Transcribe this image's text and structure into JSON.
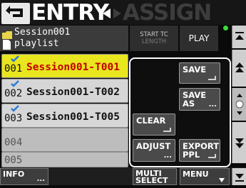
{
  "header": {
    "back_icon": "back-arrow-icon",
    "tab_entry": "ENTRY",
    "tab_arrows_icon": "left-right-arrows-icon",
    "tab_assign": "ASSIGN"
  },
  "session": {
    "name": "Session001",
    "playlist": "playlist",
    "folder_icon": "folder-icon",
    "doc_icon": "document-icon"
  },
  "columns": {
    "start_tc": "START TC",
    "length": "LENGTH",
    "play": "PLAY"
  },
  "rows": [
    {
      "num": "001",
      "name": "Session001-T001",
      "selected": true,
      "checked": true
    },
    {
      "num": "002",
      "name": "Session001-T002",
      "selected": false,
      "checked": true
    },
    {
      "num": "003",
      "name": "Session001-T005",
      "selected": false,
      "checked": true
    },
    {
      "num": "004",
      "name": "",
      "selected": false,
      "checked": false
    },
    {
      "num": "005",
      "name": "",
      "selected": false,
      "checked": false
    }
  ],
  "popup": {
    "save": "SAVE",
    "save_as_line1": "SAVE",
    "save_as_line2": "AS",
    "save_as_sub": "...",
    "clear": "CLEAR",
    "adjust": "ADJUST",
    "adjust_sub": "...",
    "export_line1": "EXPORT",
    "export_line2": "PPL"
  },
  "bottom": {
    "info": "INFO",
    "info_sub": "...",
    "multi_select_1": "MULTI",
    "multi_select_2": "SELECT",
    "menu": "MENU"
  },
  "colors": {
    "selected_row": "#e9e51e",
    "selected_text": "#c40000",
    "status_led": "#3bd93b"
  }
}
